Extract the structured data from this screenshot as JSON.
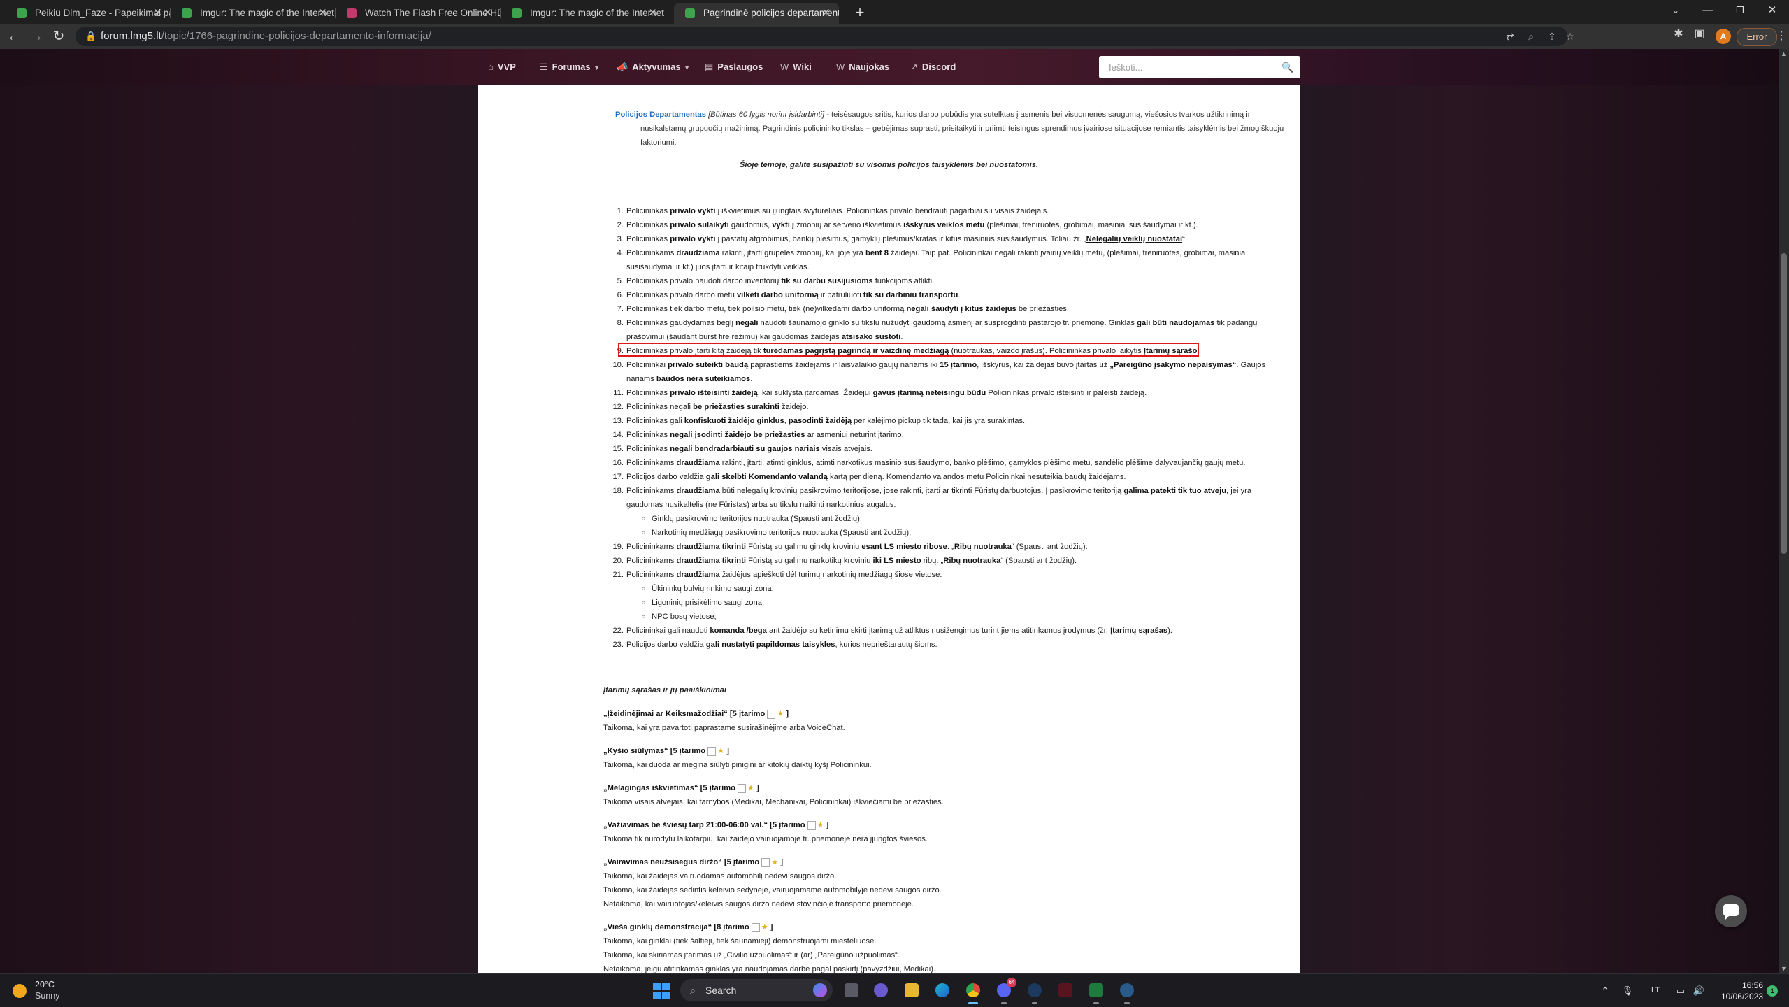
{
  "browser": {
    "tabs": [
      {
        "title": "Peikiu Dlm_Faze - Papeikimai par",
        "favicon_color": "#3fa34d",
        "active": false
      },
      {
        "title": "Imgur: The magic of the Internet",
        "favicon_color": "#3fa34d",
        "active": false
      },
      {
        "title": "Watch The Flash Free Online HD",
        "favicon_color": "#c23a6b",
        "active": false
      },
      {
        "title": "Imgur: The magic of the Internet",
        "favicon_color": "#3fa34d",
        "active": false
      },
      {
        "title": "Pagrindinė policijos departament",
        "favicon_color": "#3fa34d",
        "active": true
      }
    ],
    "url_host": "forum.lmg5.lt",
    "url_path": "/topic/1766-pagrindine-policijos-departamento-informacija/",
    "error_label": "Error",
    "profile_initial": "A"
  },
  "site_nav": {
    "items": [
      {
        "label": "VVP",
        "icon": "home-icon"
      },
      {
        "label": "Forumas",
        "icon": "list-icon",
        "dropdown": true
      },
      {
        "label": "Aktyvumas",
        "icon": "megaphone-icon",
        "dropdown": true
      },
      {
        "label": "Paslaugos",
        "icon": "store-icon"
      },
      {
        "label": "Wiki",
        "icon": "w-icon"
      },
      {
        "label": "Naujokas",
        "icon": "w-icon"
      },
      {
        "label": "Discord",
        "icon": "external-link-icon"
      }
    ],
    "search_placeholder": "Ieškoti..."
  },
  "content": {
    "intro_link": "Policijos Departamentas",
    "intro_req": "[Būtinas 60 lygis norint įsidarbinti]",
    "intro_text": " - teisėsaugos sritis, kurios darbo pobūdis yra sutelktas į asmenis bei visuomenės saugumą, viešosios tvarkos užtikrinimą ir nusikalstamų grupuočių mažinimą. Pagrindinis policininko tikslas – gebėjimas suprasti, prisitaikyti ir priimti teisingus sprendimus įvairiose situacijose remiantis taisyklėmis bei žmogiškuoju faktoriumi.",
    "subtitle": "Šioje temoje, galite susipažinti su visomis policijos taisyklėmis bei nuostatomis.",
    "rules": [
      {
        "n": "1.",
        "parts": [
          [
            "t",
            "Policininkas "
          ],
          [
            "b",
            "privalo vykti"
          ],
          [
            "t",
            " į iškvietimus su įjungtais švyturėliais. Policininkas privalo bendrauti pagarbiai su visais žaidėjais."
          ]
        ]
      },
      {
        "n": "2.",
        "parts": [
          [
            "t",
            "Policininkas "
          ],
          [
            "b",
            "privalo sulaikyti"
          ],
          [
            "t",
            " gaudomus, "
          ],
          [
            "b",
            "vykti į"
          ],
          [
            "t",
            " žmonių ar serverio iškvietimus "
          ],
          [
            "b",
            "išskyrus veiklos metu"
          ],
          [
            "t",
            " (plėšimai, treniruotės, grobimai, masiniai susišaudymai ir kt.)."
          ]
        ]
      },
      {
        "n": "3.",
        "parts": [
          [
            "t",
            "Policininkas "
          ],
          [
            "b",
            "privalo vykti"
          ],
          [
            "t",
            " į pastatų atgrobimus, bankų plėšimus, gamyklų plėšimus/kratas ir kitus masinius susišaudymus. Toliau žr. „"
          ],
          [
            "bu",
            "Nelegalių veiklų nuostatai"
          ],
          [
            "t",
            "“."
          ]
        ]
      },
      {
        "n": "4.",
        "parts": [
          [
            "t",
            "Policininkams "
          ],
          [
            "b",
            "draudžiama"
          ],
          [
            "t",
            " rakinti, įtarti grupelės žmonių, kai joje yra "
          ],
          [
            "b",
            "bent 8"
          ],
          [
            "t",
            " žaidėjai. Taip pat. Policininkai negali rakinti įvairių veiklų metu, (plėšimai, treniruotės, grobimai, masiniai susišaudymai ir kt.) juos įtarti ir kitaip trukdyti veiklas."
          ]
        ]
      },
      {
        "n": "5.",
        "parts": [
          [
            "t",
            "Policininkas privalo naudoti darbo inventorių "
          ],
          [
            "b",
            "tik su darbu susijusioms"
          ],
          [
            "t",
            " funkcijoms atlikti."
          ]
        ]
      },
      {
        "n": "6.",
        "parts": [
          [
            "t",
            "Policininkas privalo darbo metu "
          ],
          [
            "b",
            "vilkėti darbo uniformą"
          ],
          [
            "t",
            " ir patruliuoti "
          ],
          [
            "b",
            "tik su darbiniu transportu"
          ],
          [
            "t",
            "."
          ]
        ]
      },
      {
        "n": "7.",
        "parts": [
          [
            "t",
            "Policininkas tiek darbo metu, tiek poilsio metu, tiek (ne)vilkėdami darbo uniformą "
          ],
          [
            "b",
            "negali šaudyti į kitus žaidėjus"
          ],
          [
            "t",
            " be priežasties."
          ]
        ]
      },
      {
        "n": "8.",
        "parts": [
          [
            "t",
            "Policininkas gaudydamas bėglį "
          ],
          [
            "b",
            "negali"
          ],
          [
            "t",
            " naudoti šaunamojo ginklo su tikslu nužudyti gaudomą asmenį ar susprogdinti pastarojo tr. priemonę. Ginklas "
          ],
          [
            "b",
            "gali būti naudojamas"
          ],
          [
            "t",
            " tik padangų prašovimui (šaudant burst fire režimu) kai gaudomas žaidėjas "
          ],
          [
            "b",
            "atsisako sustoti"
          ],
          [
            "t",
            "."
          ]
        ]
      },
      {
        "n": "9.",
        "parts": [
          [
            "t",
            "Policininkas privalo įtarti kitą žaidėją tik "
          ],
          [
            "b",
            "turėdamas pagrįstą pagrindą ir vaizdinę medžiagą"
          ],
          [
            "t",
            " (nuotraukas, vaizdo įrašus). Policininkas privalo laikytis "
          ],
          [
            "b",
            "Įtarimų sąrašo"
          ],
          [
            "t",
            "."
          ]
        ]
      },
      {
        "n": "10.",
        "parts": [
          [
            "t",
            "Policininkai "
          ],
          [
            "b",
            "privalo suteikti baudą"
          ],
          [
            "t",
            " paprastiems žaidėjams ir laisvalaikio gaujų nariams iki "
          ],
          [
            "b",
            "15 įtarimo"
          ],
          [
            "t",
            ", išskyrus, kai žaidėjas buvo įtartas už "
          ],
          [
            "b",
            "„Pareigūno įsakymo nepaisymas“"
          ],
          [
            "t",
            ". Gaujos nariams "
          ],
          [
            "b",
            "baudos nėra suteikiamos"
          ],
          [
            "t",
            "."
          ]
        ]
      },
      {
        "n": "11.",
        "parts": [
          [
            "t",
            "Policininkas "
          ],
          [
            "b",
            "privalo išteisinti žaidėją"
          ],
          [
            "t",
            ", kai suklysta įtardamas. Žaidėjui "
          ],
          [
            "b",
            "gavus įtarimą neteisingu būdu"
          ],
          [
            "t",
            " Policininkas privalo išteisinti ir paleisti žaidėją."
          ]
        ]
      },
      {
        "n": "12.",
        "parts": [
          [
            "t",
            "Policininkas negali "
          ],
          [
            "b",
            "be priežasties surakinti"
          ],
          [
            "t",
            " žaidėjo."
          ]
        ]
      },
      {
        "n": "13.",
        "parts": [
          [
            "t",
            "Policininkas gali "
          ],
          [
            "b",
            "konfiskuoti žaidėjo ginklus"
          ],
          [
            "t",
            ", "
          ],
          [
            "b",
            "pasodinti žaidėją"
          ],
          [
            "t",
            " per kalėjimo pickup tik tada, kai jis yra surakintas."
          ]
        ]
      },
      {
        "n": "14.",
        "parts": [
          [
            "t",
            "Policininkas "
          ],
          [
            "b",
            "negali įsodinti žaidėjo be priežasties"
          ],
          [
            "t",
            " ar asmeniui neturint įtarimo."
          ]
        ]
      },
      {
        "n": "15.",
        "parts": [
          [
            "t",
            "Policininkas "
          ],
          [
            "b",
            "negali bendradarbiauti su gaujos nariais"
          ],
          [
            "t",
            " visais atvejais."
          ]
        ]
      },
      {
        "n": "16.",
        "parts": [
          [
            "t",
            "Policininkams "
          ],
          [
            "b",
            "draudžiama"
          ],
          [
            "t",
            " rakinti, įtarti, atimti ginklus, atimti narkotikus masinio susišaudymo, banko plėšimo, gamyklos plėšimo metu, sandėlio plėšime dalyvaujančių gaujų metu."
          ]
        ]
      },
      {
        "n": "17.",
        "parts": [
          [
            "t",
            "Policijos darbo valdžia "
          ],
          [
            "b",
            "gali skelbti Komendanto valandą"
          ],
          [
            "t",
            " kartą per dieną. Komendanto valandos metu Policininkai nesuteikia baudų žaidėjams."
          ]
        ]
      },
      {
        "n": "18.",
        "parts": [
          [
            "t",
            "Policininkams "
          ],
          [
            "b",
            "draudžiama"
          ],
          [
            "t",
            " būti nelegalių krovinių pasikrovimo teritorijose, jose  rakinti, įtarti ar tikrinti Fūristų darbuotojus. Į pasikrovimo teritoriją "
          ],
          [
            "b",
            "galima patekti tik tuo atveju"
          ],
          [
            "t",
            ", jei yra gaudomas nusikaltėlis (ne Fūristas) arba su tikslu naikinti narkotinius augalus."
          ]
        ],
        "sub": [
          [
            [
              "u",
              "Ginklų pasikrovimo teritorijos nuotrauka"
            ],
            [
              "t",
              " (Spausti ant žodžių);"
            ]
          ],
          [
            [
              "u",
              "Narkotinių medžiagų pasikrovimo teritorijos nuotrauka"
            ],
            [
              "t",
              " (Spausti ant žodžių);"
            ]
          ]
        ]
      },
      {
        "n": "19.",
        "parts": [
          [
            "t",
            "Policininkams "
          ],
          [
            "b",
            "draudžiama tikrinti"
          ],
          [
            "t",
            " Fūristą su galimu ginklų kroviniu "
          ],
          [
            "b",
            "esant LS miesto ribose"
          ],
          [
            "t",
            ". „"
          ],
          [
            "bu",
            "Ribų nuotrauka"
          ],
          [
            "t",
            "“ (Spausti ant žodžių)."
          ]
        ]
      },
      {
        "n": "20.",
        "parts": [
          [
            "t",
            "Policininkams "
          ],
          [
            "b",
            "draudžiama tikrinti"
          ],
          [
            "t",
            " Fūristą su galimu narkotikų kroviniu "
          ],
          [
            "b",
            "iki LS miesto"
          ],
          [
            "t",
            " ribų. „"
          ],
          [
            "bu",
            "Ribų nuotrauka"
          ],
          [
            "t",
            "“ (Spausti ant žodžių)."
          ]
        ]
      },
      {
        "n": "21.",
        "parts": [
          [
            "t",
            "Policininkams "
          ],
          [
            "b",
            "draudžiama"
          ],
          [
            "t",
            " žaidėjus apieškoti dėl turimų narkotinių medžiagų šiose vietose:"
          ]
        ],
        "sub": [
          [
            [
              "t",
              "Ūkininkų bulvių rinkimo saugi zona;"
            ]
          ],
          [
            [
              "t",
              "Ligoninių prisikėlimo saugi zona;"
            ]
          ],
          [
            [
              "t",
              "NPC bosų vietose;"
            ]
          ]
        ]
      },
      {
        "n": "22.",
        "parts": [
          [
            "t",
            "Policininkai gali naudoti "
          ],
          [
            "b",
            "komanda /bega"
          ],
          [
            "t",
            " ant žaidėjo su ketinimu skirti įtarimą už atliktus nusižengimus turint jiems atitinkamus įrodymus (žr. "
          ],
          [
            "b",
            "Įtarimų sąrašas"
          ],
          [
            "t",
            ")."
          ]
        ]
      },
      {
        "n": "23.",
        "parts": [
          [
            "t",
            "Policijos darbo valdžia "
          ],
          [
            "b",
            "gali nustatyti papildomas taisykles"
          ],
          [
            "t",
            ", kurios neprieštarautų šioms."
          ]
        ]
      }
    ],
    "charges_header": "Įtarimų sąrašas ir jų paaiškinimai",
    "charges": [
      {
        "name": "„Įžeidinėjimai ar Keiksmažodžiai“ [5 įtarimo",
        "close": "]",
        "desc": [
          "Taikoma, kai yra pavartoti paprastame susirašinėjime arba VoiceChat."
        ]
      },
      {
        "name": "„Kyšio siūlymas“ [5 įtarimo",
        "close": "]",
        "desc": [
          "Taikoma, kai duoda ar mėgina siūlyti pinigini ar kitokių daiktų kyšį Policininkui."
        ]
      },
      {
        "name": "„Melagingas iškvietimas“ [5 įtarimo",
        "close": "]",
        "desc": [
          "Taikoma visais atvejais, kai tarnybos (Medikai, Mechanikai, Policininkai) iškviečiami be priežasties."
        ]
      },
      {
        "name": "„Važiavimas be šviesų tarp 21:00-06:00 val.“ [5 įtarimo",
        "close": "]",
        "desc": [
          "Taikoma tik nurodytu laikotarpiu, kai žaidėjo vairuojamoje tr. priemonėje nėra įjungtos šviesos."
        ]
      },
      {
        "name": "„Vairavimas neužsisegus diržo“ [5 įtarimo",
        "close": "]",
        "desc": [
          "Taikoma, kai žaidėjas vairuodamas automobilį nedėvi saugos diržo.",
          "Taikoma, kai žaidėjas sėdintis keleivio sėdynėje, vairuojamame automobilyje nedėvi saugos diržo.",
          "Netaikoma, kai vairuotojas/keleivis saugos diržo nedėvi stovinčioje transporto priemonėje."
        ]
      },
      {
        "name": "„Vieša ginklų demonstracija“ [8 įtarimo",
        "close": "]",
        "desc": [
          "Taikoma, kai ginklai (tiek šaltieji, tiek šaunamieji) demonstruojami miesteliuose.",
          "Taikoma, kai skiriamas įtarimas už „Civilio užpuolimas“ ir (ar) „Pareigūno užpuolimas“.",
          "Netaikoma, jeigu atitinkamas ginklas yra naudojamas darbe pagal paskirtį (pavyzdžiui, Medikai)."
        ]
      }
    ]
  },
  "taskbar": {
    "weather_temp": "20°C",
    "weather_desc": "Sunny",
    "search_label": "Search",
    "discord_badge": "64",
    "lang": "LT",
    "time": "16:56",
    "date": "10/06/2023",
    "notif_count": "1"
  },
  "colors": {
    "accent_red": "#e01818",
    "link_blue": "#1f6cbf"
  }
}
